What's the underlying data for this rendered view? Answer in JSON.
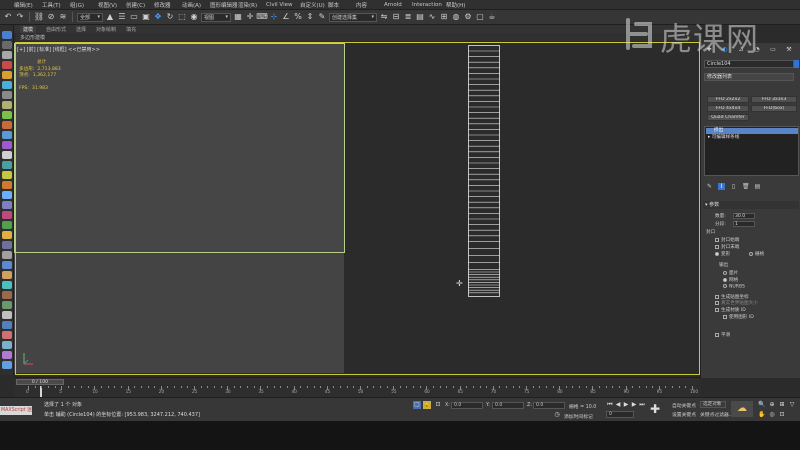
{
  "menu": [
    "编辑(E)",
    "工具(T)",
    "组(G)",
    "视图(V)",
    "创建(C)",
    "修改器",
    "动画(A)",
    "图形编辑器",
    "渲染(R)",
    "Civil View",
    "自定义(U)",
    "脚本",
    "内容",
    "Arnold",
    "Interaction",
    "帮助(H)"
  ],
  "toolbar": {
    "selection_filter": "全部",
    "view_mode": "视图",
    "named_selection": "创建选择集"
  },
  "ribbon": {
    "tabs": [
      "建模",
      "自由形式",
      "选择",
      "对象绘制",
      "填充"
    ],
    "sub_label": "多边形建模"
  },
  "viewport": {
    "label": "[+] [前] [标准] [线框] <<已禁用>>",
    "stats": {
      "header": "总计",
      "polygons_label": "多边形:",
      "polygons_value": "2,713,883",
      "vertices_label": "顶点:",
      "vertices_value": "1,362,177",
      "fps_label": "FPS:",
      "fps_value": "31.983"
    }
  },
  "command_panel": {
    "object_name": "Circle104",
    "modifier_list": "修改器列表",
    "buttons": [
      "FFD 2x2x2",
      "FFD 3x3x3",
      "FFD 4x4x4",
      "FFD(box)",
      "Quad Chamfer",
      "Displacement"
    ],
    "stack": [
      "挤出",
      "可编辑样条线"
    ],
    "rollout": "参数",
    "amount_label": "数量:",
    "amount_value": "30.0",
    "segments_label": "分段:",
    "segments_value": "1",
    "capping_label": "封口",
    "cap_start": "封口始端",
    "cap_end": "封口末端",
    "morph": "变形",
    "grid": "栅格",
    "output_label": "输出",
    "patch": "面片",
    "mesh": "网格",
    "nurbs": "NURBS",
    "gen_mapping": "生成贴图坐标",
    "real_world": "真实世界贴图大小",
    "gen_material_ids": "生成材质 ID",
    "use_shape_ids": "使用图形 ID",
    "smooth": "平滑"
  },
  "timeline": {
    "frame_display": "0 / 100",
    "ticks": [
      "0",
      "5",
      "10",
      "15",
      "20",
      "25",
      "30",
      "35",
      "40",
      "45",
      "50",
      "55",
      "60",
      "65",
      "70",
      "75",
      "80",
      "85",
      "90",
      "95",
      "100"
    ]
  },
  "status": {
    "maxscript": "MAXScript 迷",
    "selection": "选择了 1 个 对象",
    "prompt": "单击 辅助 (Circle104) 的坐标位置: [953.983, 3247.212, 740.437]",
    "x_label": "X:",
    "x_value": "0.0",
    "y_label": "Y:",
    "y_value": "0.0",
    "z_label": "Z:",
    "z_value": "0.0",
    "grid": "栅格 = 10.0",
    "add_time_tag": "添加时间标记",
    "auto_key": "自动关键点",
    "selected_obj": "选定对象",
    "set_key": "设置关键点",
    "key_filters": "关键点过滤器...",
    "frame": "0"
  },
  "watermark": {
    "text": "虎课网"
  },
  "colors": {
    "viewport_border": "#c9c93a",
    "stats_text": "#e6c74a",
    "accent_blue": "#3b73d3"
  }
}
